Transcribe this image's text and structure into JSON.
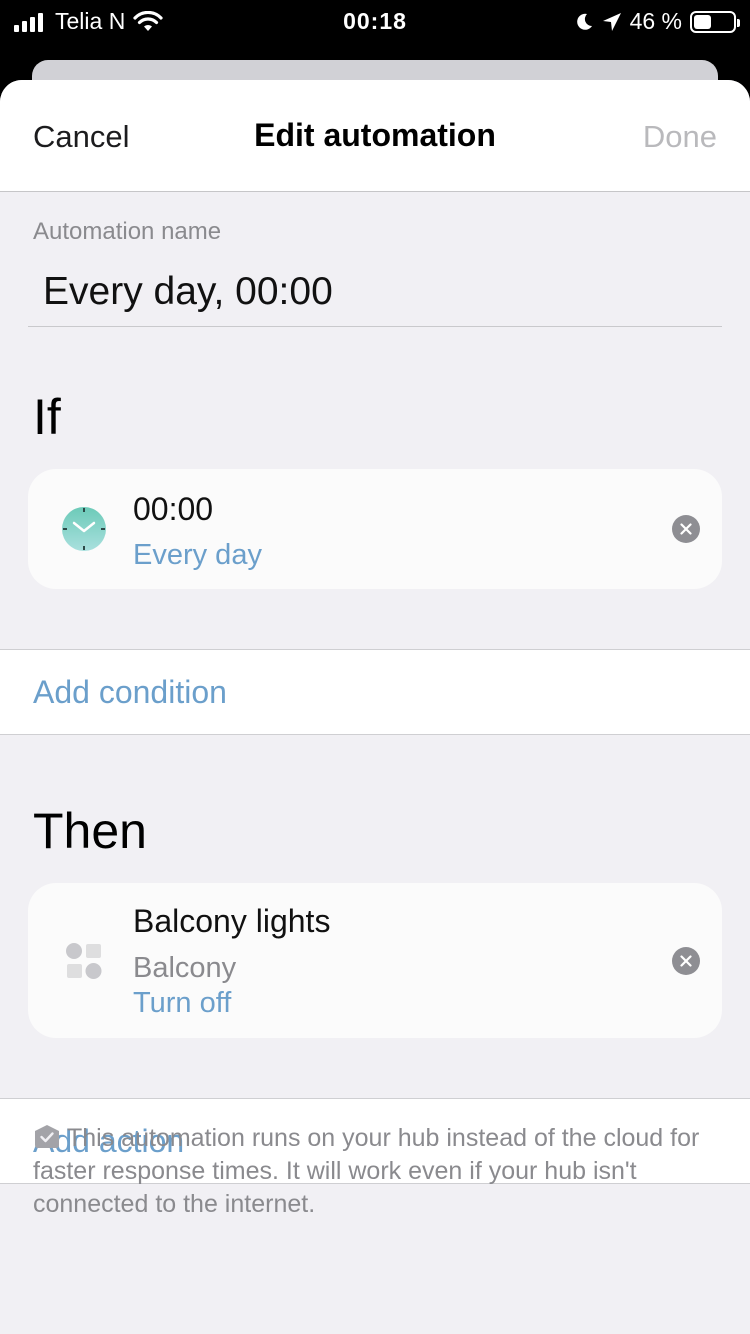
{
  "status_bar": {
    "carrier": "Telia N",
    "time": "00:18",
    "battery": "46 %"
  },
  "nav": {
    "cancel": "Cancel",
    "title": "Edit automation",
    "done": "Done"
  },
  "automation_name": {
    "label": "Automation name",
    "value": "Every day, 00:00"
  },
  "if_section": {
    "title": "If",
    "trigger": {
      "time": "00:00",
      "repeat": "Every day",
      "icon": "clock-icon"
    },
    "add_label": "Add condition"
  },
  "then_section": {
    "title": "Then",
    "action": {
      "device": "Balcony lights",
      "room": "Balcony",
      "command": "Turn off",
      "icon": "device-group-icon"
    },
    "add_label": "Add action"
  },
  "footer": {
    "note": "This automation runs on your hub instead of the cloud for faster response times. It will work even if your hub isn't connected to the internet."
  },
  "colors": {
    "accent": "#6b9fcb",
    "background": "#f1f0f4",
    "clock": "#7ecfc6"
  }
}
